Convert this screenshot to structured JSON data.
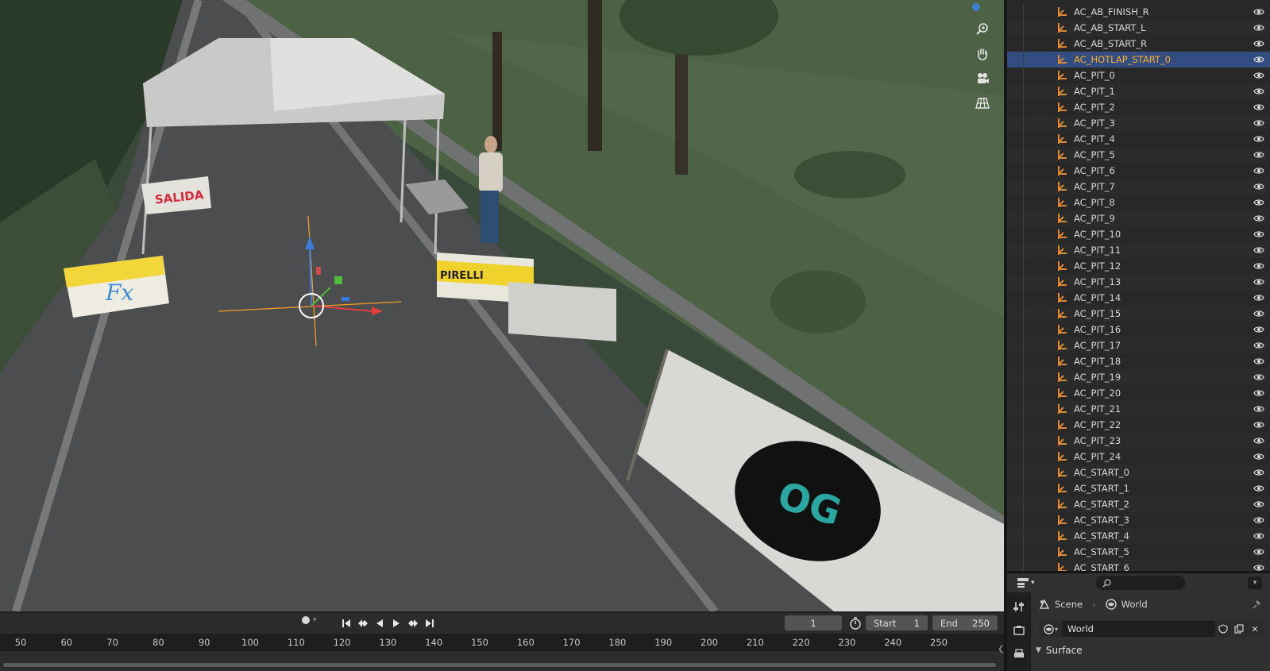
{
  "viewport": {
    "nav_tools": [
      "zoom-icon",
      "pan-hand-icon",
      "camera-icon",
      "ortho-grid-icon"
    ],
    "signs": {
      "salida": "SALIDA",
      "pirelli": "PIRELLI",
      "fx": "Fx",
      "banner_logo": "OG"
    }
  },
  "timeline": {
    "current_frame": "1",
    "start_label": "Start",
    "start_value": "1",
    "end_label": "End",
    "end_value": "250",
    "ruler": [
      "50",
      "60",
      "70",
      "80",
      "90",
      "100",
      "110",
      "120",
      "130",
      "140",
      "150",
      "160",
      "170",
      "180",
      "190",
      "200",
      "210",
      "220",
      "230",
      "240",
      "250"
    ]
  },
  "outliner": {
    "selected_index": 3,
    "items": [
      "AC_AB_FINISH_R",
      "AC_AB_START_L",
      "AC_AB_START_R",
      "AC_HOTLAP_START_0",
      "AC_PIT_0",
      "AC_PIT_1",
      "AC_PIT_2",
      "AC_PIT_3",
      "AC_PIT_4",
      "AC_PIT_5",
      "AC_PIT_6",
      "AC_PIT_7",
      "AC_PIT_8",
      "AC_PIT_9",
      "AC_PIT_10",
      "AC_PIT_11",
      "AC_PIT_12",
      "AC_PIT_13",
      "AC_PIT_14",
      "AC_PIT_15",
      "AC_PIT_16",
      "AC_PIT_17",
      "AC_PIT_18",
      "AC_PIT_19",
      "AC_PIT_20",
      "AC_PIT_21",
      "AC_PIT_22",
      "AC_PIT_23",
      "AC_PIT_24",
      "AC_START_0",
      "AC_START_1",
      "AC_START_2",
      "AC_START_3",
      "AC_START_4",
      "AC_START_5",
      "AC_START_6"
    ]
  },
  "properties": {
    "breadcrumb": {
      "scene": "Scene",
      "world": "World"
    },
    "world_name": "World",
    "panel_surface": "Surface"
  },
  "colors": {
    "selection": "#334d80",
    "selected_text": "#ffaf29",
    "empty_icon": "#e08a36",
    "grass": "#4a5e41",
    "road": "#4b4d4e"
  }
}
